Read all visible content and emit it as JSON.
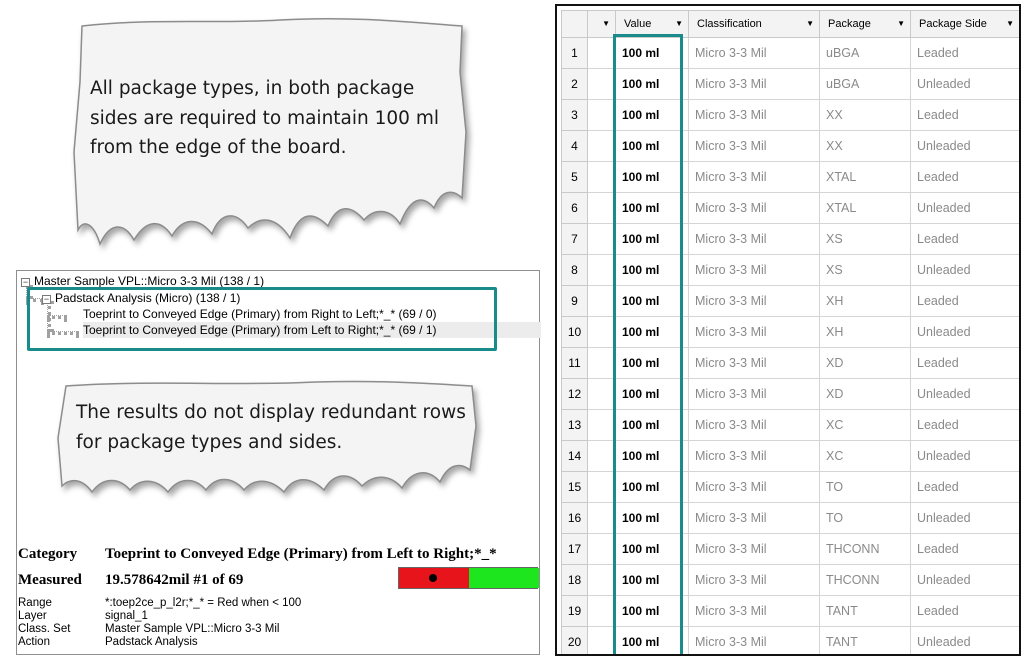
{
  "notes": {
    "top": "All package types, in both package sides are required to maintain 100 ml from the edge of the board.",
    "middle": "The results do not display redundant rows for package types and sides."
  },
  "tree": {
    "root": "Master Sample VPL::Micro 3-3 Mil (138 / 1)",
    "child": "Padstack Analysis (Micro) (138 / 1)",
    "leaves": [
      "Toeprint to Conveyed Edge (Primary) from Right to Left;*_* (69 / 0)",
      "Toeprint to Conveyed Edge (Primary) from Left to Right;*_* (69 / 1)"
    ],
    "toggle_symbol": "−"
  },
  "info": {
    "category_label": "Category",
    "category_value": "Toeprint to Conveyed Edge (Primary) from Left to Right;*_*",
    "measured_label": "Measured",
    "measured_value": "19.578642mil #1 of 69",
    "details": [
      {
        "label": "Range",
        "value": "*:toep2ce_p_l2r;*_* = Red when < 100"
      },
      {
        "label": "Layer",
        "value": "signal_1"
      },
      {
        "label": "Class. Set",
        "value": "Master Sample VPL::Micro 3-3 Mil"
      },
      {
        "label": "Action",
        "value": "Padstack Analysis"
      }
    ],
    "meter_colors": {
      "bad": "#e8141c",
      "good": "#1ee61e"
    }
  },
  "grid": {
    "columns": [
      "",
      "Value",
      "Classification",
      "Package",
      "Package Side"
    ],
    "dropdown_icon": "▼",
    "rows": [
      {
        "n": "1",
        "value": "100 ml",
        "classification": "Micro 3-3 Mil",
        "package": "uBGA",
        "side": "Leaded"
      },
      {
        "n": "2",
        "value": "100 ml",
        "classification": "Micro 3-3 Mil",
        "package": "uBGA",
        "side": "Unleaded"
      },
      {
        "n": "3",
        "value": "100 ml",
        "classification": "Micro 3-3 Mil",
        "package": "XX",
        "side": "Leaded"
      },
      {
        "n": "4",
        "value": "100 ml",
        "classification": "Micro 3-3 Mil",
        "package": "XX",
        "side": "Unleaded"
      },
      {
        "n": "5",
        "value": "100 ml",
        "classification": "Micro 3-3 Mil",
        "package": "XTAL",
        "side": "Leaded"
      },
      {
        "n": "6",
        "value": "100 ml",
        "classification": "Micro 3-3 Mil",
        "package": "XTAL",
        "side": "Unleaded"
      },
      {
        "n": "7",
        "value": "100 ml",
        "classification": "Micro 3-3 Mil",
        "package": "XS",
        "side": "Leaded"
      },
      {
        "n": "8",
        "value": "100 ml",
        "classification": "Micro 3-3 Mil",
        "package": "XS",
        "side": "Unleaded"
      },
      {
        "n": "9",
        "value": "100 ml",
        "classification": "Micro 3-3 Mil",
        "package": "XH",
        "side": "Leaded"
      },
      {
        "n": "10",
        "value": "100 ml",
        "classification": "Micro 3-3 Mil",
        "package": "XH",
        "side": "Unleaded"
      },
      {
        "n": "11",
        "value": "100 ml",
        "classification": "Micro 3-3 Mil",
        "package": "XD",
        "side": "Leaded"
      },
      {
        "n": "12",
        "value": "100 ml",
        "classification": "Micro 3-3 Mil",
        "package": "XD",
        "side": "Unleaded"
      },
      {
        "n": "13",
        "value": "100 ml",
        "classification": "Micro 3-3 Mil",
        "package": "XC",
        "side": "Leaded"
      },
      {
        "n": "14",
        "value": "100 ml",
        "classification": "Micro 3-3 Mil",
        "package": "XC",
        "side": "Unleaded"
      },
      {
        "n": "15",
        "value": "100 ml",
        "classification": "Micro 3-3 Mil",
        "package": "TO",
        "side": "Leaded"
      },
      {
        "n": "16",
        "value": "100 ml",
        "classification": "Micro 3-3 Mil",
        "package": "TO",
        "side": "Unleaded"
      },
      {
        "n": "17",
        "value": "100 ml",
        "classification": "Micro 3-3 Mil",
        "package": "THCONN",
        "side": "Leaded"
      },
      {
        "n": "18",
        "value": "100 ml",
        "classification": "Micro 3-3 Mil",
        "package": "THCONN",
        "side": "Unleaded"
      },
      {
        "n": "19",
        "value": "100 ml",
        "classification": "Micro 3-3 Mil",
        "package": "TANT",
        "side": "Leaded"
      },
      {
        "n": "20",
        "value": "100 ml",
        "classification": "Micro 3-3 Mil",
        "package": "TANT",
        "side": "Unleaded"
      }
    ]
  },
  "colors": {
    "highlight": "#1a8b8b",
    "header_bg": "#f3f3f3",
    "muted_text": "#8a8a8a"
  }
}
